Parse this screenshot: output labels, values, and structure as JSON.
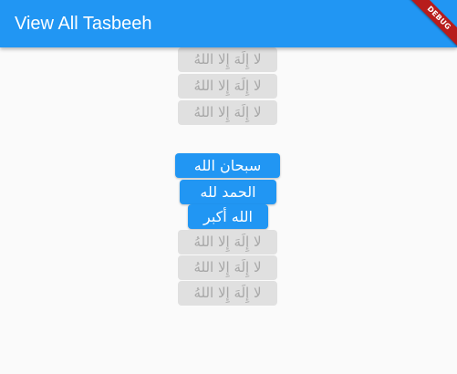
{
  "appbar": {
    "title": "View All Tasbeeh",
    "debug_label": "DEBUG"
  },
  "tasbeeh_top": [
    {
      "label": "لا إِلَهَ إِلا اللهُ"
    },
    {
      "label": "لا إِلَهَ إِلا اللهُ"
    },
    {
      "label": "لا إِلَهَ إِلا اللهُ"
    }
  ],
  "tasbeeh_main": [
    {
      "label": "سبحان الله"
    },
    {
      "label": "الحمد لله"
    },
    {
      "label": "الله أكبر"
    }
  ],
  "tasbeeh_bottom": [
    {
      "label": "لا إِلَهَ إِلا اللهُ"
    },
    {
      "label": "لا إِلَهَ إِلا اللهُ"
    },
    {
      "label": "لا إِلَهَ إِلا اللهُ"
    }
  ],
  "colors": {
    "primary": "#2196f3",
    "disabled_bg": "#e0e0e0",
    "disabled_text": "#a8a8a8",
    "background": "#fafafa",
    "debug_banner": "#b71c1c"
  }
}
